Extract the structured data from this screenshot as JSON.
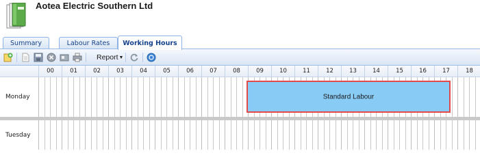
{
  "header": {
    "company_name": "Aotea Electric Southern Ltd",
    "logo_icon": "binder-book-icon"
  },
  "tabs": [
    {
      "label": "Summary",
      "active": false
    },
    {
      "label": "Labour Rates",
      "active": false
    },
    {
      "label": "Working Hours",
      "active": true
    }
  ],
  "toolbar": {
    "icons": [
      "add-icon",
      "document-icon",
      "save-icon",
      "cancel-icon",
      "card-icon",
      "print-icon",
      "refresh-icon",
      "help-icon"
    ],
    "report_label": "Report"
  },
  "schedule": {
    "hours": [
      "00",
      "01",
      "02",
      "03",
      "04",
      "05",
      "06",
      "07",
      "08",
      "09",
      "10",
      "11",
      "12",
      "13",
      "14",
      "15",
      "16",
      "17",
      "18"
    ],
    "days": [
      {
        "label": "Monday",
        "blocks": [
          {
            "label": "Standard Labour",
            "start_hour": 9.0,
            "end_hour": 18.0
          }
        ]
      },
      {
        "label": "Tuesday",
        "blocks": []
      }
    ],
    "colors": {
      "block_fill": "#88cbf5",
      "block_border": "#e24a4a"
    }
  }
}
